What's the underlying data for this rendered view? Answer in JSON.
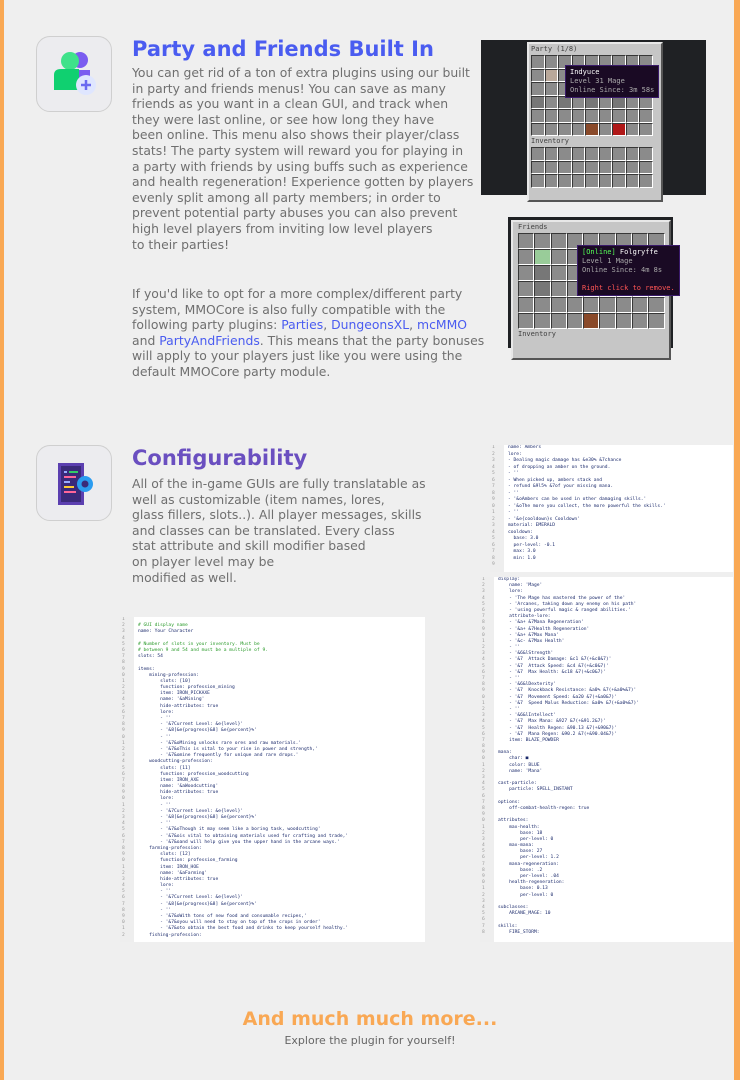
{
  "party_section": {
    "title": "Party and Friends Built In",
    "body": "You can get rid of a ton of extra plugins using our built\nin party and friends menus! You can save as many\nfriends as you want in a clean GUI, and track when\nthey were last online, or see how long they have\nbeen online. This menu also shows their player/class\nstats! The party system will reward you for playing in\na party with friends by using buffs such as experience\nand health regeneration! Experience gotten by players\nevenly split among all party members; in order to\nprevent potential party abuses you can also prevent\nhigh level players from inviting low level players\nto their parties!",
    "compat_intro": "If you'd like to opt for a more complex/different party\nsystem, MMOCore is also fully compatible with the\nfollowing party plugins: ",
    "links": [
      "Parties",
      "DungeonsXL",
      "mcMMO",
      "PartyAndFriends"
    ],
    "sep1": ", ",
    "sep2": ", ",
    "sep3": "\nand ",
    "compat_outro": ". This means that the party bonuses\nwill apply to your players just like you were using the\ndefault MMOCore party module.",
    "party_gui": {
      "title": "Party (1/8)",
      "inventory_label": "Inventory",
      "tooltip": {
        "name": "Indyuce",
        "line1": "Level 31 Mage",
        "line2": "Online Since: 3m 58s"
      }
    },
    "friends_gui": {
      "title": "Friends",
      "inventory_label": "Inventory",
      "tooltip": {
        "status": "[Online]",
        "name": " Folgryffe",
        "line1": "Level 1 Mage",
        "line2": "Online Since: 4m 8s",
        "action": "Right click to remove."
      }
    }
  },
  "config_section": {
    "title": "Configurability",
    "body": "All of the in-game GUIs are fully translatable as\nwell as customizable (item names, lores,\nglass fillers, slots..). All player messages, skills\nand classes can be translated. Every class\nstat attribute and skill modifier based\non player level may be\nmodified as well."
  },
  "code_skill": [
    "name: Ambers",
    "lore:",
    "- Dealing magic damage has &e30% &7chance",
    "- of dropping an amber on the ground.",
    "- ''",
    "- When picked up, ambers stack and",
    "- refund &9l5% &7of your missing mana.",
    "- ''",
    "- '&oAmbers can be used in other damaging skills.'",
    "- '&oThe more you collect, the more powerful the skills.'",
    "- ''",
    "- '&e{cooldown}s Cooldown'",
    "material: EMERALD",
    "cooldown:",
    "  base: 3.0",
    "  per-level: -0.1",
    "  max: 3.0",
    "  min: 1.0",
    ""
  ],
  "code_gui": [
    "",
    "# GUI display name",
    "name: Your Character",
    "",
    "# Number of slots in your inventory. Must be",
    "# between 9 and 54 and must be a multiple of 9.",
    "slots: 54",
    "",
    "items:",
    "    mining-profession:",
    "        slots: [10]",
    "        function: profession_mining",
    "        item: IRON_PICKAXE",
    "        name: '&aMining'",
    "        hide-attributes: true",
    "        lore:",
    "        - ''",
    "        - '&7Current Level: &e{level}'",
    "        - '&8[&e{progress}&8] &e{percent}%'",
    "        - ''",
    "        - '&7&oMining unlocks rare ores and raw materials.'",
    "        - '&7&oThis is vital to your rise in power and strength,'",
    "        - '&7&omine frequently for unique and rare drops.'",
    "    woodcutting-profession:",
    "        slots: [11]",
    "        function: profession_woodcutting",
    "        item: IRON_AXE",
    "        name: '&aWoodcutting'",
    "        hide-attributes: true",
    "        lore:",
    "        - ''",
    "        - '&7Current Level: &e{level}'",
    "        - '&8[&e{progress}&8] &e{percent}%'",
    "        - ''",
    "        - '&7&oThough it may seem like a boring task, woodcutting'",
    "        - '&7&ois vital to obtaining materials used for crafting and trade,'",
    "        - '&7&oand will help give you the upper hand in the arcane ways.'",
    "    farming-profession:",
    "        slots: [12]",
    "        function: profession_farming",
    "        item: IRON_HOE",
    "        name: '&aFarming'",
    "        hide-attributes: true",
    "        lore:",
    "        - ''",
    "        - '&7Current Level: &e{level}'",
    "        - '&8[&e{progress}&8] &e{percent}%'",
    "        - ''",
    "        - '&7&oWith tons of new food and consumable recipes,'",
    "        - '&7&oyou will need to stay on top of the crops in order'",
    "        - '&7&oto obtain the best food and drinks to keep yourself healthy.'",
    "    fishing-profession:"
  ],
  "code_class": [
    "display:",
    "    name: 'Mage'",
    "    lore:",
    "    - 'The Mage has mastered the power of the'",
    "    - 'Arcanes, taking down any enemy on his path'",
    "    - 'using powerful magic & ranged abilities.'",
    "    attribute-lore:",
    "    - '&a+ &7Mana Regeneration'",
    "    - '&a+ &7Health Regeneration'",
    "    - '&a+ &7Max Mana'",
    "    - '&c- &7Max Health'",
    "    - ''",
    "    - '&6&lStrength'",
    "    - '&7  Attack Damage: &c1 &7(+&c0&7)'",
    "    - '&7  Attack Speed: &c4 &7(+&c0&7)'",
    "    - '&7  Max Health: &c18 &7(+&c0&7)'",
    "    - ''",
    "    - '&6&lDexterity'",
    "    - '&7  Knockback Resistance: &a0% &7(+&a0%&7)'",
    "    - '&7  Movement Speed: &a20 &7(+&a0&7)'",
    "    - '&7  Speed Malus Reduction: &a0% &7(+&a0%&7)'",
    "    - ''",
    "    - '&6&lIntellect'",
    "    - '&7  Max Mana: &927 &7(+&91.2&7)'",
    "    - '&7  Health Regen: &90.13 &7(+&90&7)'",
    "    - '&7  Mana Regen: &90.2 &7(+&90.04&7)'",
    "    item: BLAZE_POWDER",
    "",
    "mana:",
    "    char: ■",
    "    color: BLUE",
    "    name: 'Mana'",
    "",
    "cast-particle:",
    "    particle: SPELL_INSTANT",
    "",
    "options:",
    "    off-combat-health-regen: true",
    "",
    "attributes:",
    "    max-health:",
    "        base: 18",
    "        per-level: 0",
    "    max-mana:",
    "        base: 27",
    "        per-level: 1.2",
    "    mana-regeneration:",
    "        base: .2",
    "        per-level: .04",
    "    health-regeneration:",
    "        base: 0.13",
    "        per-level: 0",
    "",
    "subclasses:",
    "    ARCANE_MAGE: 10",
    "",
    "skills:",
    "    FIRE_STORM:"
  ],
  "footer": {
    "title": "And much much more...",
    "subtitle": "Explore the plugin for yourself!"
  },
  "colors": {
    "accent_blue": "#4a5cf0",
    "accent_purple": "#6a4fc0",
    "orange": "#f9a854"
  }
}
